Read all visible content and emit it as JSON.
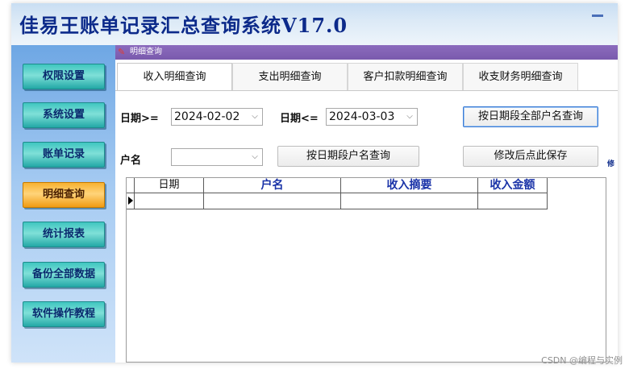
{
  "app": {
    "title": "佳易王账单记录汇总查询系统V17.0"
  },
  "sidebar": {
    "items": [
      {
        "label": "权限设置",
        "active": false
      },
      {
        "label": "系统设置",
        "active": false
      },
      {
        "label": "账单记录",
        "active": false
      },
      {
        "label": "明细查询",
        "active": true
      },
      {
        "label": "统计报表",
        "active": false
      },
      {
        "label": "备份全部数据",
        "active": false
      },
      {
        "label": "软件操作教程",
        "active": false
      }
    ]
  },
  "panel": {
    "title": "明细查询",
    "tabs": [
      {
        "label": "收入明细查询",
        "active": true
      },
      {
        "label": "支出明细查询",
        "active": false
      },
      {
        "label": "客户扣款明细查询",
        "active": false
      },
      {
        "label": "收支财务明细查询",
        "active": false
      }
    ]
  },
  "filters": {
    "date_from_label": "日期>=",
    "date_from_value": "2024-02-02",
    "date_to_label": "日期<=",
    "date_to_value": "2024-03-03",
    "query_all_button": "按日期段全部户名查询",
    "account_label": "户名",
    "account_value": "",
    "query_account_button": "按日期段户名查询",
    "save_button": "修改后点此保存",
    "side_char": "修"
  },
  "grid": {
    "columns": [
      "日期",
      "户名",
      "收入摘要",
      "收入金额"
    ],
    "rows": [
      [
        "",
        "",
        "",
        ""
      ]
    ]
  },
  "watermark": "CSDN @编程与实例",
  "colors": {
    "title": "#0c2a8a",
    "nav_button": "#3fc6c0",
    "nav_active": "#f7b12f",
    "panel_head": "#7a5aad",
    "header_text": "#1a33a8"
  }
}
